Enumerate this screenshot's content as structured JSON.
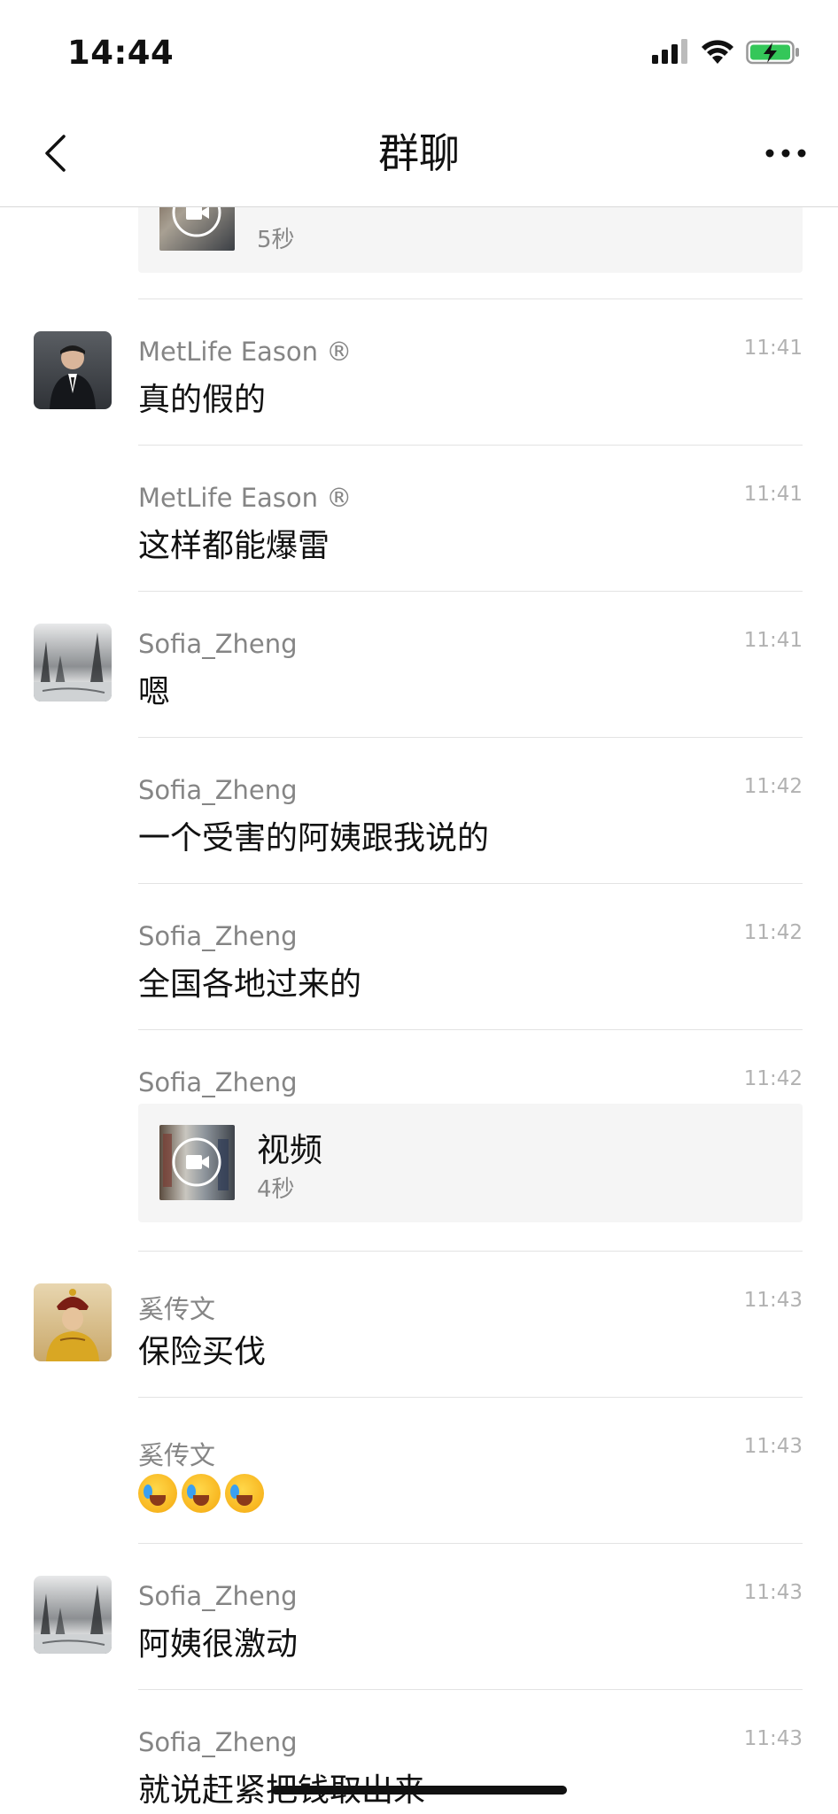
{
  "status_bar": {
    "time": "14:44"
  },
  "nav": {
    "title": "群聊"
  },
  "video_top": {
    "duration": "5秒"
  },
  "messages": [
    {
      "sender": "MetLife Eason ®",
      "time": "11:41",
      "text": "真的假的"
    },
    {
      "sender": "MetLife Eason ®",
      "time": "11:41",
      "text": "这样都能爆雷"
    },
    {
      "sender": "Sofia_Zheng",
      "time": "11:41",
      "text": "嗯"
    },
    {
      "sender": "Sofia_Zheng",
      "time": "11:42",
      "text": "一个受害的阿姨跟我说的"
    },
    {
      "sender": "Sofia_Zheng",
      "time": "11:42",
      "text": "全国各地过来的"
    },
    {
      "sender": "Sofia_Zheng",
      "time": "11:42",
      "video_title": "视频",
      "video_duration": "4秒"
    },
    {
      "sender": "奚传文",
      "time": "11:43",
      "text": "保险买伐"
    },
    {
      "sender": "奚传文",
      "time": "11:43",
      "emoji": [
        "crying-laughing",
        "crying-laughing",
        "crying-laughing"
      ]
    },
    {
      "sender": "Sofia_Zheng",
      "time": "11:43",
      "text": "阿姨很激动"
    },
    {
      "sender": "Sofia_Zheng",
      "time": "11:43",
      "text": "就说赶紧把钱取出来"
    }
  ]
}
